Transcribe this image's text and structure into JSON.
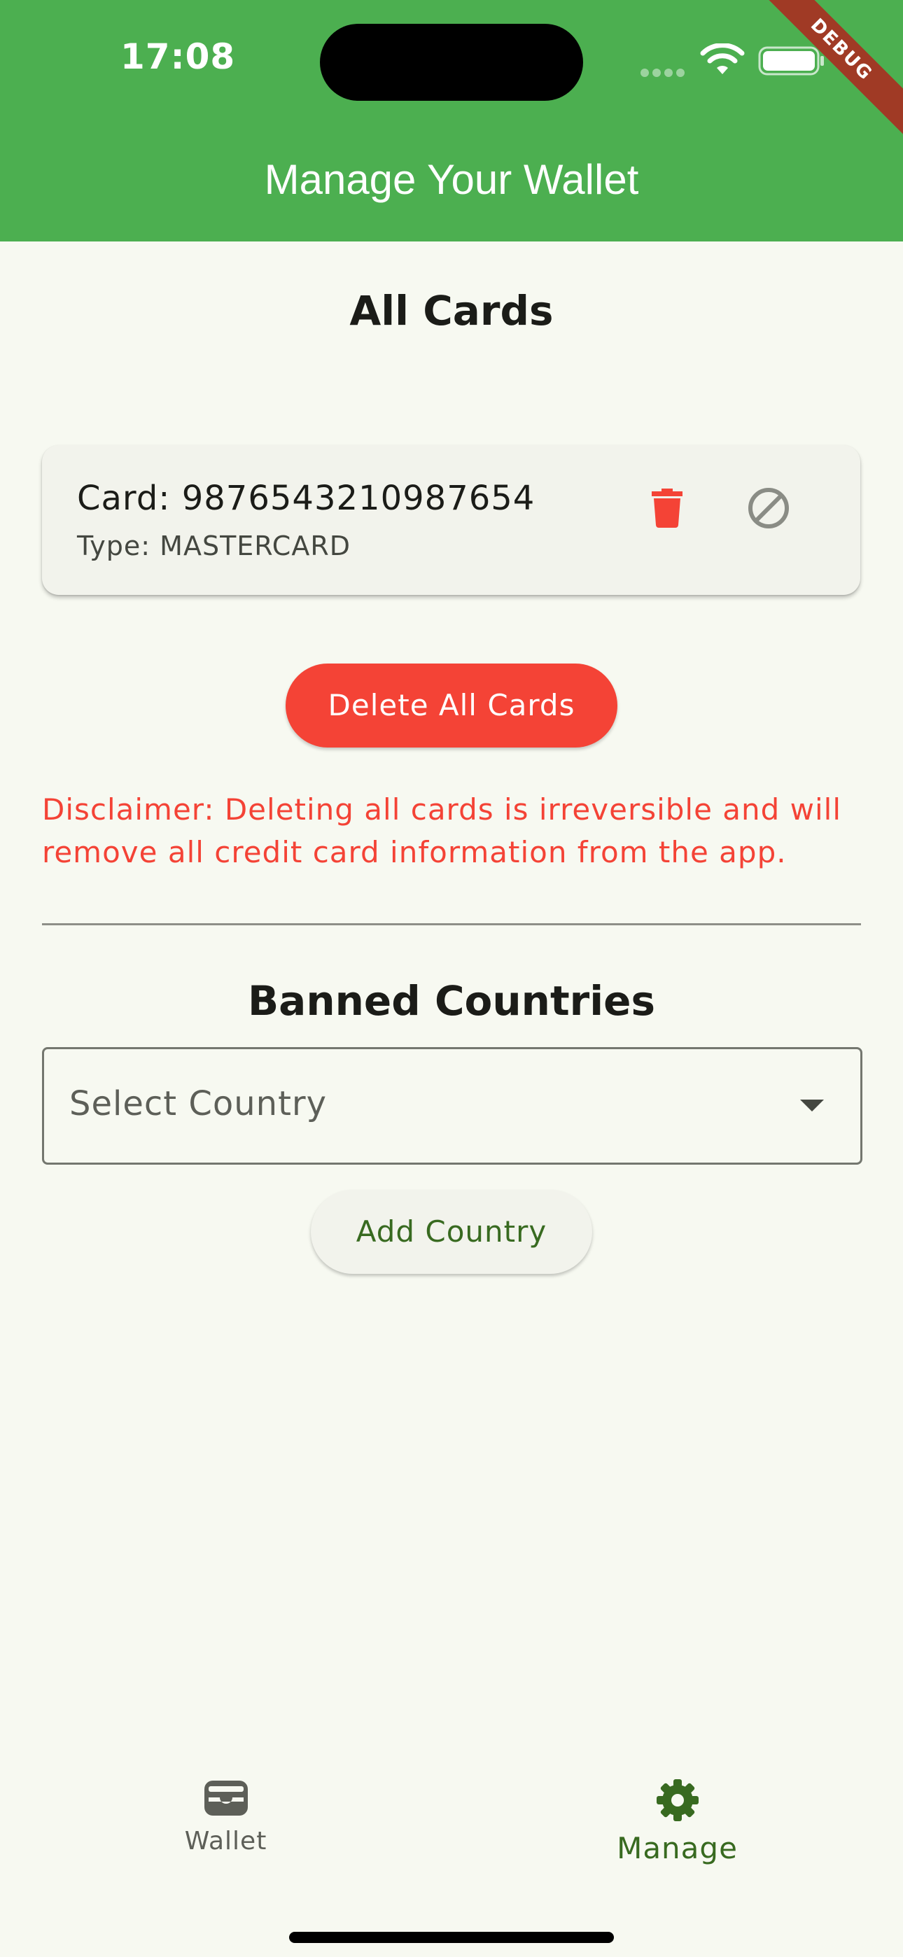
{
  "status_bar": {
    "time": "17:08",
    "debug_label": "DEBUG"
  },
  "app_bar": {
    "title": "Manage Your Wallet",
    "color": "#4caf50"
  },
  "cards_section": {
    "title": "All Cards",
    "cards": [
      {
        "number_text": "Card: 9876543210987654",
        "type_text": "Type: MASTERCARD",
        "actions": [
          "trash-icon",
          "block-icon"
        ]
      }
    ],
    "delete_all_label": "Delete All Cards",
    "disclaimer": "Disclaimer: Deleting all cards is irreversible and will remove all credit card information from the app.",
    "danger_color": "#f44336"
  },
  "banned_section": {
    "title": "Banned Countries",
    "select_placeholder": "Select Country",
    "add_label": "Add Country"
  },
  "bottom_nav": {
    "items": [
      {
        "label": "Wallet",
        "icon": "wallet-icon",
        "selected": false
      },
      {
        "label": "Manage",
        "icon": "gear-icon",
        "selected": true
      }
    ],
    "selected_color": "#386a20"
  }
}
